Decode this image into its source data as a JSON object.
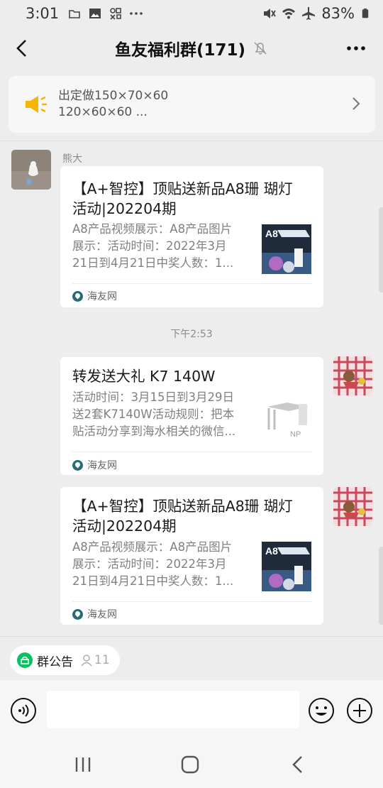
{
  "status_bar": {
    "time": "3:01",
    "battery": "83%"
  },
  "header": {
    "title": "鱼友福利群(171)"
  },
  "notice": {
    "line1": "出定做150×70×60",
    "line2": "120×60×60 ..."
  },
  "messages": [
    {
      "sender": "熊大",
      "title_line1": "【A+智控】顶贴送新品A8珊 瑚灯",
      "title_line2": "活动|202204期",
      "desc_line1": "A8产品视频展示：A8产品图片",
      "desc_line2": "展示：活动时间：2022年3月",
      "desc_line3": "21日到4月21日中奖人数：1...",
      "source": "海友网"
    },
    {
      "timestamp": "下午2:53"
    },
    {
      "title_line1": "转发送大礼  K7 140W",
      "desc_line1": "活动时间：3月15日到3月29日",
      "desc_line2": "送2套K7140W活动规则：把本",
      "desc_line3": "贴活动分享到海水相关的微信...",
      "source": "海友网"
    },
    {
      "title_line1": "【A+智控】顶贴送新品A8珊 瑚灯",
      "title_line2": "活动|202204期",
      "desc_line1": "A8产品视频展示：A8产品图片",
      "desc_line2": "展示：活动时间：2022年3月",
      "desc_line3": "21日到4月21日中奖人数：1...",
      "source": "海友网"
    }
  ],
  "announcement": {
    "label": "群公告",
    "count": "11"
  },
  "colors": {
    "background": "#ededed",
    "card": "#ffffff",
    "accent_green": "#07c160",
    "speaker_yellow": "#f5b500"
  }
}
